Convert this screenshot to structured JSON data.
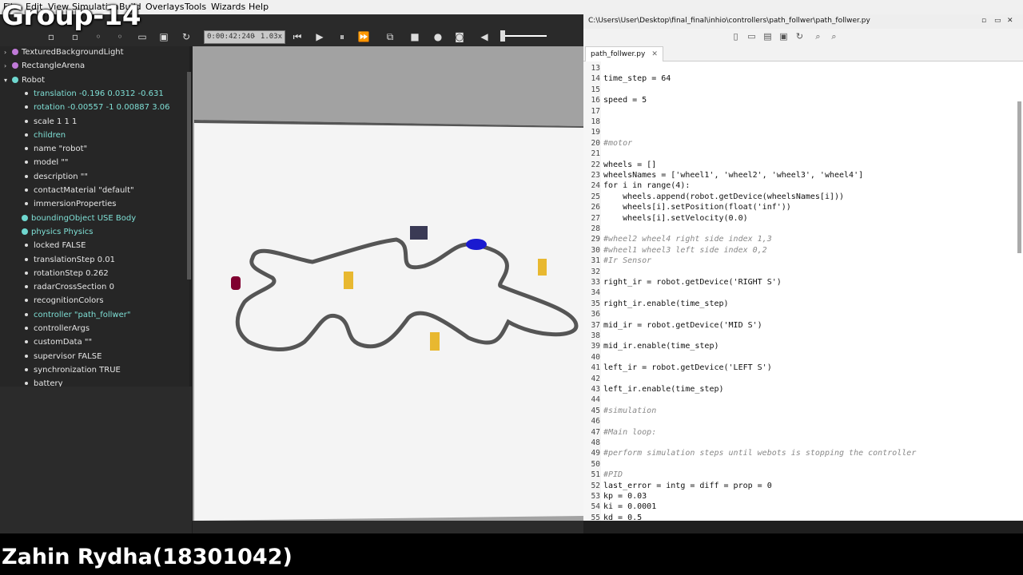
{
  "overlay": {
    "group_title": "Group-14",
    "presenter": "Zahin Rydha(18301042)"
  },
  "menu": [
    "File",
    "Edit",
    "View",
    "Simulation",
    "Build",
    "Overlays",
    "Tools",
    "Wizards",
    "Help"
  ],
  "toolbar": {
    "time": "0:00:42:240",
    "speed": "-  1.03x"
  },
  "scene_tree": [
    {
      "label": "TexturedBackgroundLight",
      "kind": "top",
      "color": "#c07ad8"
    },
    {
      "label": "RectangleArena",
      "kind": "top",
      "color": "#c07ad8"
    },
    {
      "label": "Robot",
      "kind": "top",
      "color": "#6fd7cf"
    },
    {
      "label": "translation -0.196 0.0312 -0.631",
      "kind": "field",
      "teal": true
    },
    {
      "label": "rotation -0.00557 -1 0.00887 3.06",
      "kind": "field",
      "teal": true
    },
    {
      "label": "scale 1 1 1",
      "kind": "field"
    },
    {
      "label": "children",
      "kind": "field",
      "teal": true
    },
    {
      "label": "name \"robot\"",
      "kind": "field"
    },
    {
      "label": "model \"\"",
      "kind": "field"
    },
    {
      "label": "description \"\"",
      "kind": "field"
    },
    {
      "label": "contactMaterial \"default\"",
      "kind": "field"
    },
    {
      "label": "immersionProperties",
      "kind": "field"
    },
    {
      "label": "boundingObject USE Body",
      "kind": "node",
      "teal": true,
      "color": "#6fd7cf"
    },
    {
      "label": "physics Physics",
      "kind": "node",
      "teal": true,
      "color": "#6fd7cf"
    },
    {
      "label": "locked FALSE",
      "kind": "field"
    },
    {
      "label": "translationStep 0.01",
      "kind": "field"
    },
    {
      "label": "rotationStep 0.262",
      "kind": "field"
    },
    {
      "label": "radarCrossSection 0",
      "kind": "field"
    },
    {
      "label": "recognitionColors",
      "kind": "field"
    },
    {
      "label": "controller \"path_follwer\"",
      "kind": "field",
      "teal": true
    },
    {
      "label": "controllerArgs",
      "kind": "field"
    },
    {
      "label": "customData \"\"",
      "kind": "field"
    },
    {
      "label": "supervisor FALSE",
      "kind": "field"
    },
    {
      "label": "synchronization TRUE",
      "kind": "field"
    },
    {
      "label": "battery",
      "kind": "field"
    }
  ],
  "editor": {
    "path": "C:\\Users\\User\\Desktop\\final_final\\inhio\\controllers\\path_follwer\\path_follwer.py",
    "tab": "path_follwer.py",
    "tab_close": "✕",
    "lines": [
      {
        "n": "13",
        "t": ""
      },
      {
        "n": "14",
        "t": "time_step = 64"
      },
      {
        "n": "15",
        "t": ""
      },
      {
        "n": "16",
        "t": "speed = 5"
      },
      {
        "n": "17",
        "t": ""
      },
      {
        "n": "18",
        "t": ""
      },
      {
        "n": "19",
        "t": ""
      },
      {
        "n": "20",
        "t": "#motor",
        "c": "cm"
      },
      {
        "n": "21",
        "t": ""
      },
      {
        "n": "22",
        "t": "wheels = []"
      },
      {
        "n": "23",
        "t": "wheelsNames = ['wheel1', 'wheel2', 'wheel3', 'wheel4']"
      },
      {
        "n": "24",
        "t": "for i in range(4):"
      },
      {
        "n": "25",
        "t": "    wheels.append(robot.getDevice(wheelsNames[i]))"
      },
      {
        "n": "26",
        "t": "    wheels[i].setPosition(float('inf'))"
      },
      {
        "n": "27",
        "t": "    wheels[i].setVelocity(0.0)"
      },
      {
        "n": "28",
        "t": ""
      },
      {
        "n": "29",
        "t": "#wheel2 wheel4 right side index 1,3",
        "c": "cm"
      },
      {
        "n": "30",
        "t": "#wheel1 wheel3 left side index 0,2",
        "c": "cm"
      },
      {
        "n": "31",
        "t": "#Ir Sensor",
        "c": "cm"
      },
      {
        "n": "32",
        "t": ""
      },
      {
        "n": "33",
        "t": "right_ir = robot.getDevice('RIGHT S')"
      },
      {
        "n": "34",
        "t": ""
      },
      {
        "n": "35",
        "t": "right_ir.enable(time_step)"
      },
      {
        "n": "36",
        "t": ""
      },
      {
        "n": "37",
        "t": "mid_ir = robot.getDevice('MID S')"
      },
      {
        "n": "38",
        "t": ""
      },
      {
        "n": "39",
        "t": "mid_ir.enable(time_step)"
      },
      {
        "n": "40",
        "t": ""
      },
      {
        "n": "41",
        "t": "left_ir = robot.getDevice('LEFT S')"
      },
      {
        "n": "42",
        "t": ""
      },
      {
        "n": "43",
        "t": "left_ir.enable(time_step)"
      },
      {
        "n": "44",
        "t": ""
      },
      {
        "n": "45",
        "t": "#simulation",
        "c": "cm"
      },
      {
        "n": "46",
        "t": ""
      },
      {
        "n": "47",
        "t": "#Main loop:",
        "c": "cm"
      },
      {
        "n": "48",
        "t": ""
      },
      {
        "n": "49",
        "t": "#perform simulation steps until webots is stopping the controller",
        "c": "cm"
      },
      {
        "n": "50",
        "t": ""
      },
      {
        "n": "51",
        "t": "#PID",
        "c": "cm"
      },
      {
        "n": "52",
        "t": "last_error = intg = diff = prop = 0"
      },
      {
        "n": "53",
        "t": "kp = 0.03"
      },
      {
        "n": "54",
        "t": "ki = 0.0001"
      },
      {
        "n": "55",
        "t": "kd = 0.5"
      }
    ]
  },
  "colors": {
    "code_comment": "#888888",
    "tree_teal": "#7fe0d6",
    "robot_blue": "#1a1ad0",
    "cylinder_yellow": "#e8b830"
  }
}
